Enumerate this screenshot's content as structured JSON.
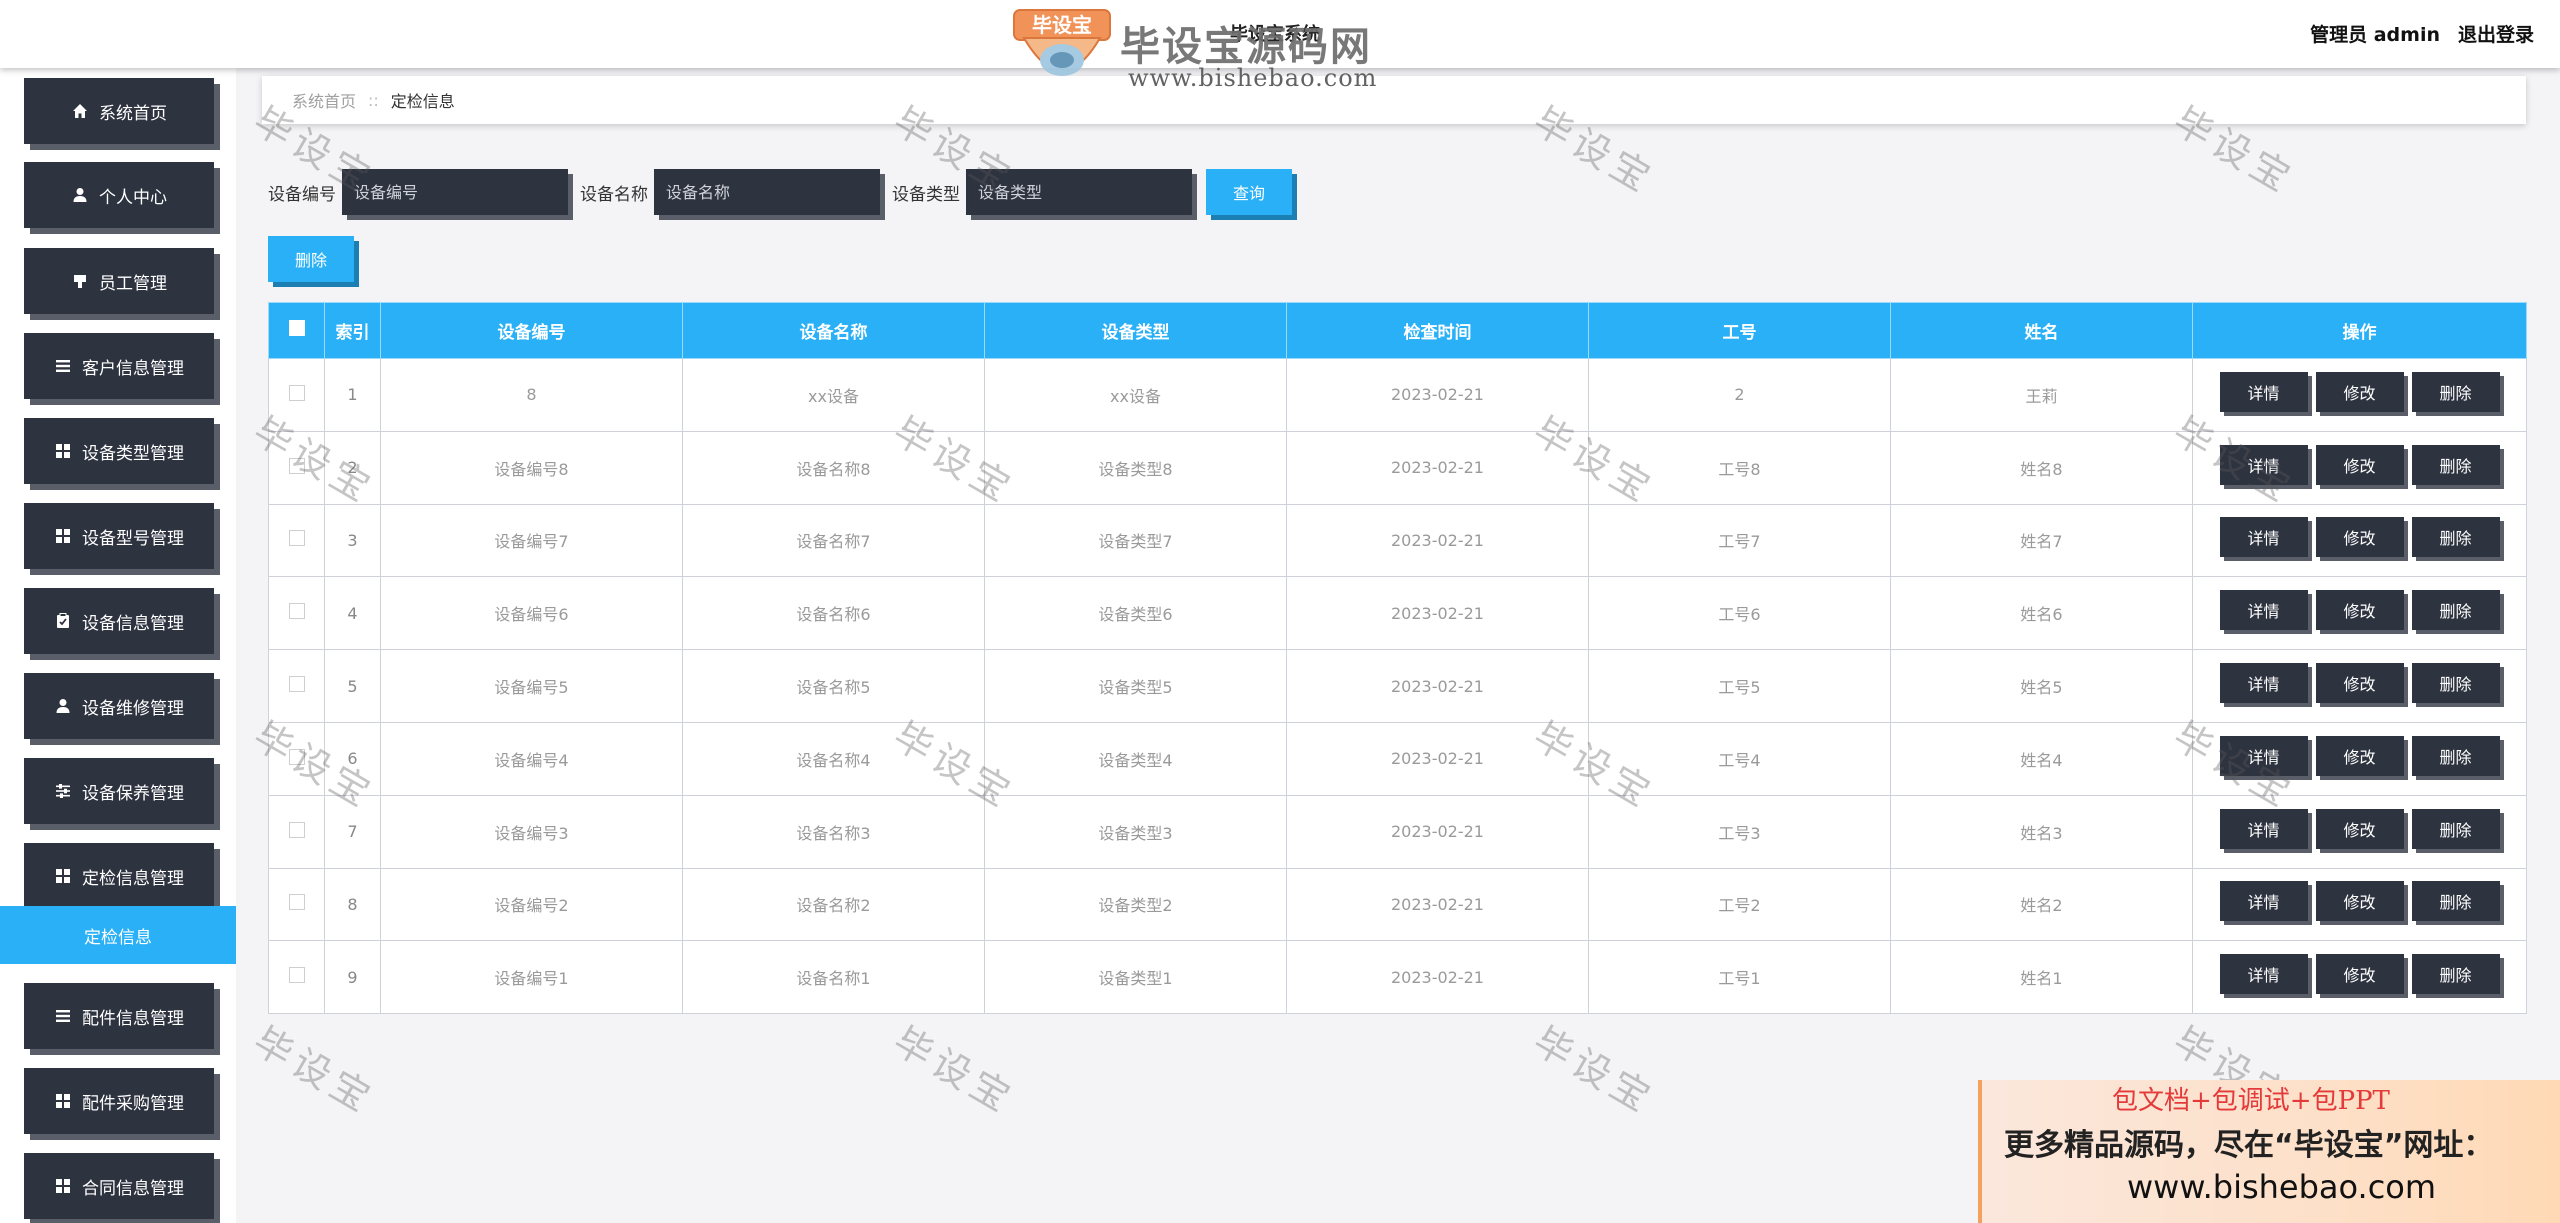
{
  "header": {
    "system_title": "毕设宝系统",
    "user_label": "管理员 admin",
    "logout": "退出登录"
  },
  "brand": {
    "badge_text": "毕设宝",
    "name": "毕设宝源码网",
    "url": "www.bishebao.com"
  },
  "sidebar": {
    "items": [
      {
        "label": "系统首页",
        "icon": "home-icon"
      },
      {
        "label": "个人中心",
        "icon": "user-icon"
      },
      {
        "label": "员工管理",
        "icon": "tag-icon"
      },
      {
        "label": "客户信息管理",
        "icon": "list-icon"
      },
      {
        "label": "设备类型管理",
        "icon": "grid-icon"
      },
      {
        "label": "设备型号管理",
        "icon": "grid-icon"
      },
      {
        "label": "设备信息管理",
        "icon": "clipboard-icon"
      },
      {
        "label": "设备维修管理",
        "icon": "user-icon"
      },
      {
        "label": "设备保养管理",
        "icon": "sliders-icon"
      },
      {
        "label": "定检信息管理",
        "icon": "grid-icon"
      },
      {
        "label": "配件信息管理",
        "icon": "list-icon"
      },
      {
        "label": "配件采购管理",
        "icon": "grid-icon"
      },
      {
        "label": "合同信息管理",
        "icon": "grid-icon"
      }
    ],
    "active_sub": "定检信息"
  },
  "breadcrumb": {
    "home": "系统首页",
    "sep": "::",
    "current": "定检信息"
  },
  "search": {
    "f1_label": "设备编号",
    "f1_placeholder": "设备编号",
    "f2_label": "设备名称",
    "f2_placeholder": "设备名称",
    "f3_label": "设备类型",
    "f3_placeholder": "设备类型",
    "query": "查询"
  },
  "toolbar": {
    "delete": "删除"
  },
  "table": {
    "headers": [
      "索引",
      "设备编号",
      "设备名称",
      "设备类型",
      "检查时间",
      "工号",
      "姓名",
      "操作"
    ],
    "actions": [
      "详情",
      "修改",
      "删除"
    ],
    "rows": [
      [
        "1",
        "8",
        "xx设备",
        "xx设备",
        "2023-02-21",
        "2",
        "王莉"
      ],
      [
        "2",
        "设备编号8",
        "设备名称8",
        "设备类型8",
        "2023-02-21",
        "工号8",
        "姓名8"
      ],
      [
        "3",
        "设备编号7",
        "设备名称7",
        "设备类型7",
        "2023-02-21",
        "工号7",
        "姓名7"
      ],
      [
        "4",
        "设备编号6",
        "设备名称6",
        "设备类型6",
        "2023-02-21",
        "工号6",
        "姓名6"
      ],
      [
        "5",
        "设备编号5",
        "设备名称5",
        "设备类型5",
        "2023-02-21",
        "工号5",
        "姓名5"
      ],
      [
        "6",
        "设备编号4",
        "设备名称4",
        "设备类型4",
        "2023-02-21",
        "工号4",
        "姓名4"
      ],
      [
        "7",
        "设备编号3",
        "设备名称3",
        "设备类型3",
        "2023-02-21",
        "工号3",
        "姓名3"
      ],
      [
        "8",
        "设备编号2",
        "设备名称2",
        "设备类型2",
        "2023-02-21",
        "工号2",
        "姓名2"
      ],
      [
        "9",
        "设备编号1",
        "设备名称1",
        "设备类型1",
        "2023-02-21",
        "工号1",
        "姓名1"
      ]
    ]
  },
  "watermark_text": "毕设宝",
  "promo": {
    "line1": "包文档+包调试+包PPT",
    "line2": "更多精品源码，尽在“毕设宝”网址：",
    "line3": "www.bishebao.com"
  },
  "colors": {
    "accent": "#29b0f6",
    "dark_button": "#2e3340",
    "shadow": "#5a5e69"
  }
}
